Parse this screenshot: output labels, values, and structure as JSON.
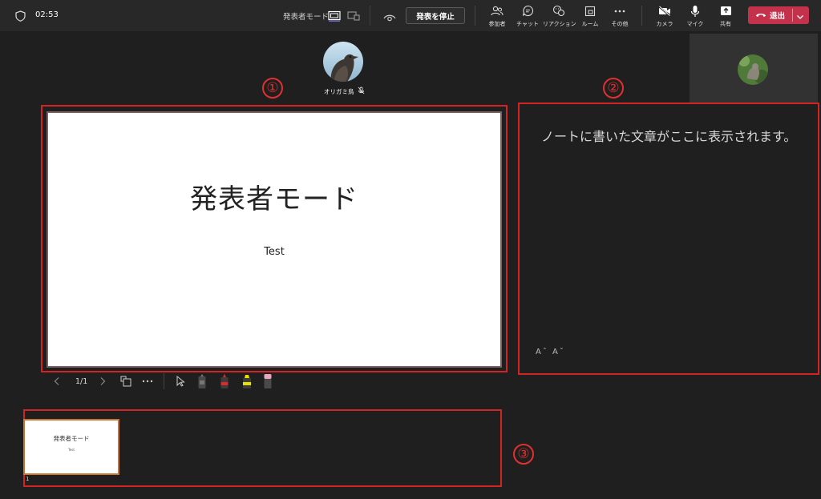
{
  "topbar": {
    "timer": "02:53",
    "mode_label": "発表者モード",
    "stop_label": "発表を停止",
    "tools": [
      {
        "label": "参加者",
        "icon": "people-icon"
      },
      {
        "label": "チャット",
        "icon": "chat-icon"
      },
      {
        "label": "リアクション",
        "icon": "reaction-icon"
      },
      {
        "label": "ルーム",
        "icon": "rooms-icon"
      },
      {
        "label": "その他",
        "icon": "more-icon"
      },
      {
        "label": "カメラ",
        "icon": "camera-off-icon"
      },
      {
        "label": "マイク",
        "icon": "mic-icon"
      },
      {
        "label": "共有",
        "icon": "share-icon"
      }
    ],
    "leave_label": "退出"
  },
  "presenter": {
    "name": "オリガミ鳥"
  },
  "markers": [
    "①",
    "②",
    "③"
  ],
  "slide": {
    "title": "発表者モード",
    "subtitle": "Test",
    "counter": "1/1"
  },
  "notes": {
    "text": "ノートに書いた文章がここに表示されます。",
    "font_controls": "Aˆ Aˇ"
  },
  "thumbnail": {
    "title": "発表者モード",
    "subtitle": "Test",
    "number": "1"
  },
  "colors": {
    "accent_red": "#d42323",
    "leave_button": "#c4314b",
    "background": "#201f1f"
  }
}
